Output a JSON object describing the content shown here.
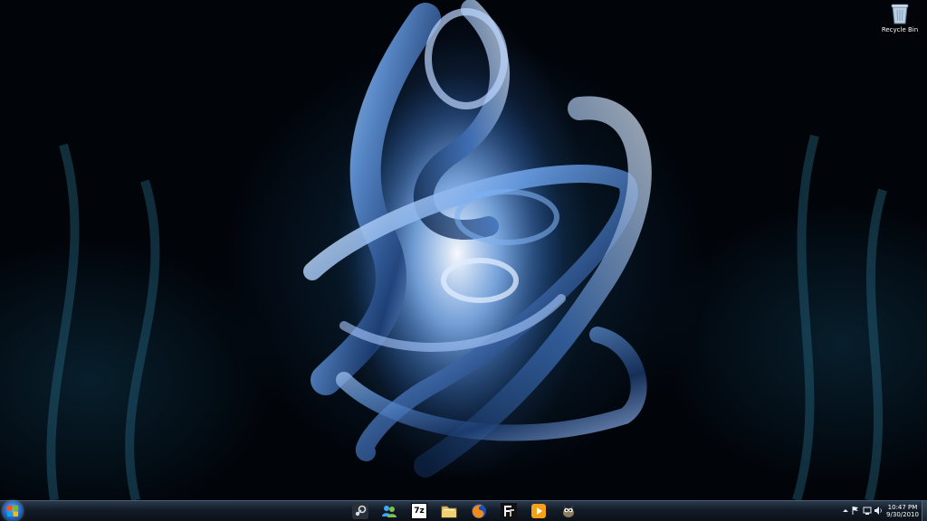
{
  "desktop": {
    "icons": [
      {
        "label": "Recycle Bin",
        "icon": "recycle-bin-icon"
      }
    ]
  },
  "taskbar": {
    "start": {
      "icon": "windows-logo-icon"
    },
    "pinned": [
      {
        "app": "Steam",
        "icon": "steam-icon"
      },
      {
        "app": "Messenger",
        "icon": "messenger-icon"
      },
      {
        "app": "7-Zip",
        "icon": "7zip-icon",
        "text": "7z"
      },
      {
        "app": "Windows Explorer",
        "icon": "folder-icon"
      },
      {
        "app": "Firefox",
        "icon": "firefox-icon"
      },
      {
        "app": "FontForge",
        "icon": "fontforge-icon"
      },
      {
        "app": "Media Player",
        "icon": "media-player-icon"
      },
      {
        "app": "GIMP",
        "icon": "gimp-icon"
      }
    ],
    "tray": {
      "icons": [
        "show-hidden-icons-arrow",
        "action-center-flag-icon",
        "network-icon",
        "volume-icon"
      ],
      "time": "10:47 PM",
      "date": "9/30/2010"
    }
  }
}
